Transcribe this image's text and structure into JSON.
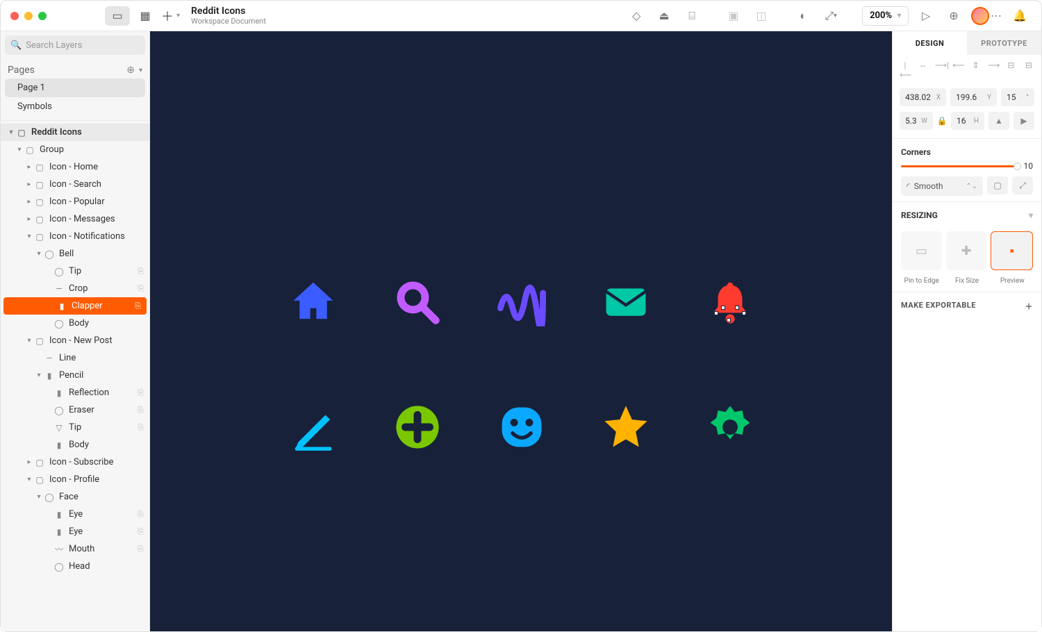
{
  "titlebar": {},
  "document": {
    "title": "Reddit Icons",
    "subtitle": "Workspace Document"
  },
  "toolbar": {
    "zoom": "200%"
  },
  "search": {
    "placeholder": "Search Layers"
  },
  "pages": {
    "header": "Pages",
    "items": [
      "Page 1",
      "Symbols"
    ]
  },
  "layers": {
    "root": "Reddit Icons",
    "rows": [
      {
        "pad": 20,
        "chev": "▾",
        "ic": "▢",
        "txt": "Group"
      },
      {
        "pad": 34,
        "chev": "▸",
        "ic": "▢",
        "txt": "Icon - Home"
      },
      {
        "pad": 34,
        "chev": "▸",
        "ic": "▢",
        "txt": "Icon - Search"
      },
      {
        "pad": 34,
        "chev": "▸",
        "ic": "▢",
        "txt": "Icon - Popular"
      },
      {
        "pad": 34,
        "chev": "▸",
        "ic": "▢",
        "txt": "Icon - Messages"
      },
      {
        "pad": 34,
        "chev": "▾",
        "ic": "▢",
        "txt": "Icon - Notifications"
      },
      {
        "pad": 48,
        "chev": "▾",
        "ic": "◯",
        "txt": "Bell"
      },
      {
        "pad": 62,
        "chev": "",
        "ic": "◯",
        "txt": "Tip",
        "link": true
      },
      {
        "pad": 62,
        "chev": "",
        "ic": "—",
        "txt": "Crop",
        "link": true
      },
      {
        "pad": 62,
        "chev": "",
        "ic": "▮",
        "txt": "Clapper",
        "link": true,
        "sel": true
      },
      {
        "pad": 62,
        "chev": "",
        "ic": "◯",
        "txt": "Body"
      },
      {
        "pad": 34,
        "chev": "▾",
        "ic": "▢",
        "txt": "Icon - New Post"
      },
      {
        "pad": 48,
        "chev": "",
        "ic": "—",
        "txt": "Line"
      },
      {
        "pad": 48,
        "chev": "▾",
        "ic": "▮",
        "txt": "Pencil"
      },
      {
        "pad": 62,
        "chev": "",
        "ic": "▮",
        "txt": "Reflection",
        "link": true
      },
      {
        "pad": 62,
        "chev": "",
        "ic": "◯",
        "txt": "Eraser",
        "link": true
      },
      {
        "pad": 62,
        "chev": "",
        "ic": "▽",
        "txt": "Tip",
        "link": true
      },
      {
        "pad": 62,
        "chev": "",
        "ic": "▮",
        "txt": "Body"
      },
      {
        "pad": 34,
        "chev": "▸",
        "ic": "▢",
        "txt": "Icon - Subscribe"
      },
      {
        "pad": 34,
        "chev": "▾",
        "ic": "▢",
        "txt": "Icon - Profile"
      },
      {
        "pad": 48,
        "chev": "▾",
        "ic": "◯",
        "txt": "Face"
      },
      {
        "pad": 62,
        "chev": "",
        "ic": "▮",
        "txt": "Eye",
        "link": true
      },
      {
        "pad": 62,
        "chev": "",
        "ic": "▮",
        "txt": "Eye",
        "link": true
      },
      {
        "pad": 62,
        "chev": "",
        "ic": "〰",
        "txt": "Mouth",
        "link": true
      },
      {
        "pad": 62,
        "chev": "",
        "ic": "◯",
        "txt": "Head"
      }
    ]
  },
  "inspector": {
    "tabs": [
      "DESIGN",
      "PROTOTYPE"
    ],
    "x": "438.02",
    "xlab": "X",
    "y": "199.6",
    "ylab": "Y",
    "rot": "15",
    "rotlab": "°",
    "w": "5.3",
    "wlab": "W",
    "h": "16",
    "hlab": "H",
    "corners_title": "Corners",
    "corners_value": "10",
    "corner_mode": "Smooth",
    "resizing_title": "RESIZING",
    "resize_labels": [
      "Pin to Edge",
      "Fix Size",
      "Preview"
    ],
    "export": "MAKE EXPORTABLE"
  }
}
